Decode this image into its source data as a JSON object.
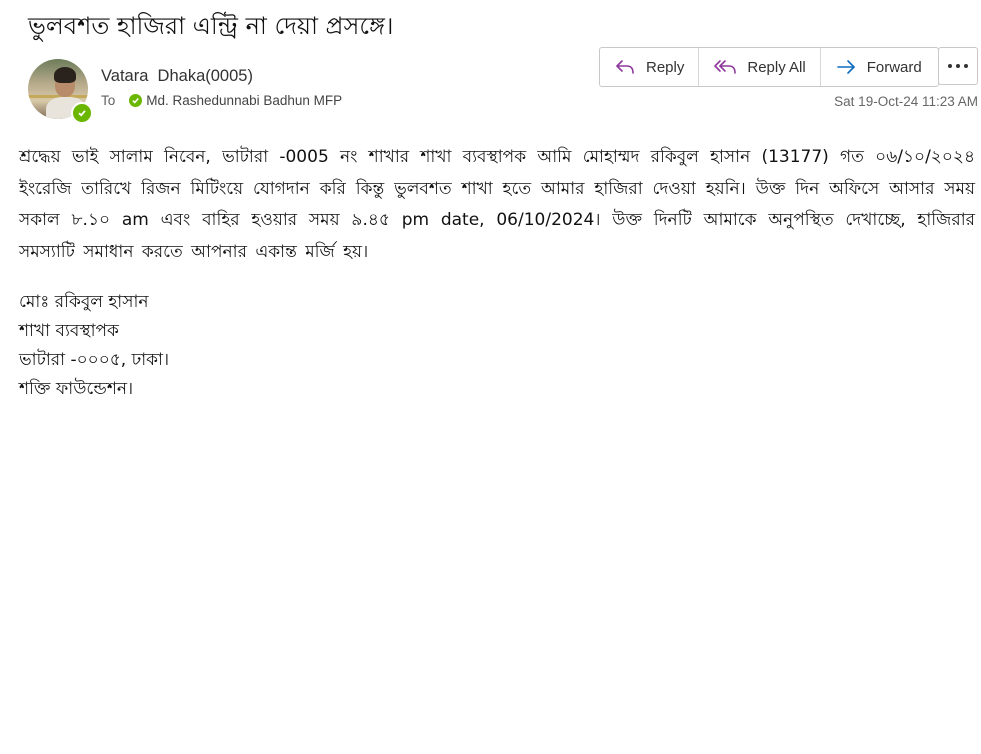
{
  "email": {
    "subject": "ভুলবশত হাজিরা এন্ট্রি না দেয়া প্রসঙ্গে।",
    "sender": "Vatara  Dhaka(0005)",
    "to_label": "To",
    "recipient": "Md. Rashedunnabi Badhun MFP",
    "timestamp": "Sat 19-Oct-24 11:23 AM",
    "body": "শ্রদ্ধেয় ভাই সালাম নিবেন, ভাটারা -0005 নং শাখার শাখা ব্যবস্থাপক আমি মোহাম্মদ রকিবুল হাসান (13177) গত ০৬/১০/২০২৪ ইংরেজি তারিখে রিজন মিটিংয়ে যোগদান করি কিন্তু ভুলবশত শাখা হতে আমার হাজিরা দেওয়া হয়নি। উক্ত দিন অফিসে আসার সময় সকাল ৮.১০ am এবং বাহির হওয়ার সময় ৯.৪৫ pm date, 06/10/2024। উক্ত দিনটি আমাকে অনুপস্থিত দেখাচ্ছে, হাজিরার সমস্যাটি সমাধান করতে আপনার একান্ত মর্জি হয়।",
    "signature": [
      "মোঃ রকিবুল হাসান",
      "শাখা ব্যবস্থাপক",
      "ভাটারা -০০০৫, ঢাকা।",
      "শক্তি ফাউন্ডেশন।"
    ]
  },
  "toolbar": {
    "reply_label": "Reply",
    "reply_all_label": "Reply All",
    "forward_label": "Forward",
    "reply_icon": "reply-icon",
    "reply_all_icon": "reply-all-icon",
    "forward_icon": "forward-icon",
    "more_icon": "more-options-icon",
    "reply_icon_color": "#8e3a9c",
    "forward_icon_color": "#0f6cbd"
  },
  "presence_color": "#6bb700"
}
